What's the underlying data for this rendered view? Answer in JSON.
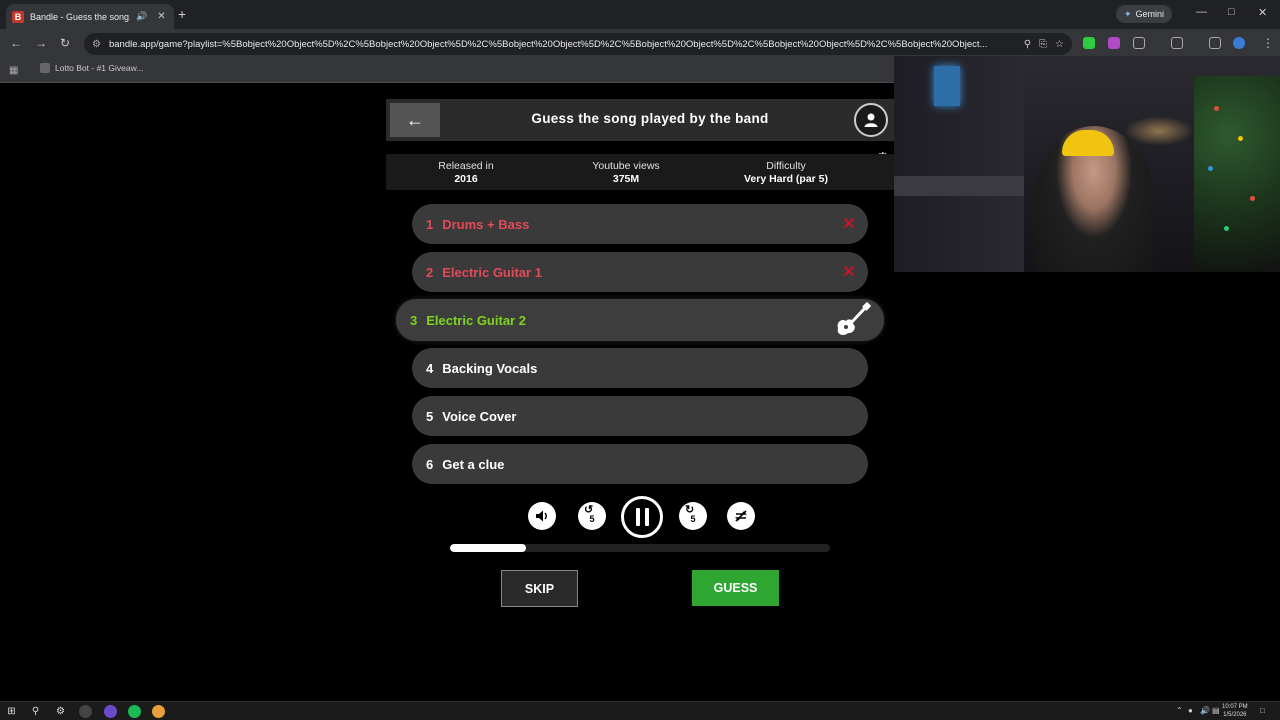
{
  "browser": {
    "tab_title": "Bandle - Guess the song, one",
    "new_tab_label": "+",
    "gemini_label": "Gemini",
    "url": "bandle.app/game?playlist=%5Bobject%20Object%5D%2C%5Bobject%20Object%5D%2C%5Bobject%20Object%5D%2C%5Bobject%20Object%5D%2C%5Bobject%20Object%5D%2C%5Bobject%20Object...",
    "bookmark_label": "Lotto Bot - #1 Giveaw..."
  },
  "game": {
    "title": "Guess the song played by the band",
    "stats": [
      {
        "label": "Released in",
        "value": "2016"
      },
      {
        "label": "Youtube views",
        "value": "375M"
      },
      {
        "label": "Difficulty",
        "value": "Very Hard (par 5)"
      }
    ],
    "tracks": [
      {
        "num": "1",
        "label": "Drums + Bass",
        "state": "wrong"
      },
      {
        "num": "2",
        "label": "Electric Guitar 1",
        "state": "wrong"
      },
      {
        "num": "3",
        "label": "Electric Guitar 2",
        "state": "active"
      },
      {
        "num": "4",
        "label": "Backing Vocals",
        "state": "locked"
      },
      {
        "num": "5",
        "label": "Voice Cover",
        "state": "locked"
      },
      {
        "num": "6",
        "label": "Get a clue",
        "state": "locked"
      }
    ],
    "controls": {
      "rewind_label": "5",
      "forward_label": "5"
    },
    "progress": 0.2,
    "skip_label": "SKIP",
    "guess_label": "GUESS",
    "colors": {
      "wrong": "#e24a5a",
      "active": "#7ed321",
      "guess": "#2ea631"
    }
  },
  "taskbar": {
    "time": "10:07 PM",
    "date": "1/5/2026"
  }
}
